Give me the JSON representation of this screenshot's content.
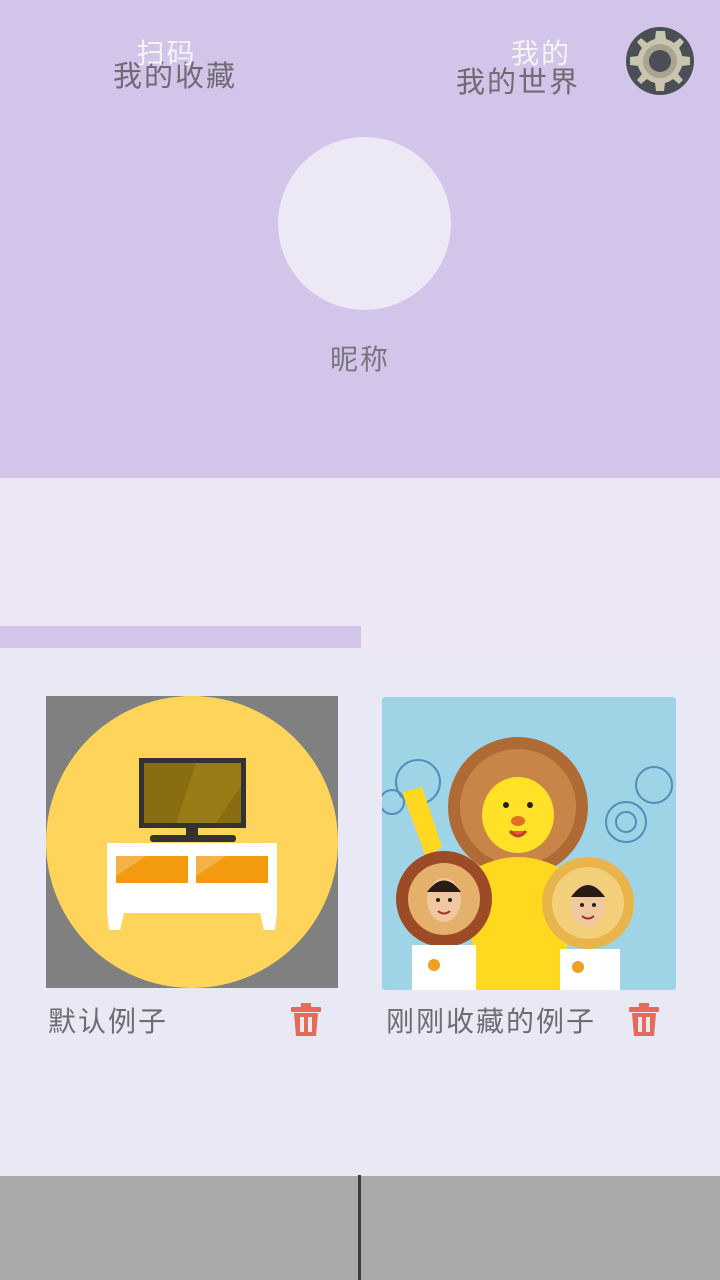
{
  "header": {
    "nickname": "昵称",
    "settings_icon": "gear-icon",
    "background_color": "#d2c5e9"
  },
  "tabs": [
    {
      "label": "我的收藏",
      "active": true
    },
    {
      "label": "我的世界",
      "active": false
    }
  ],
  "favorites": [
    {
      "label": "默认例子",
      "thumbnail_icon": "tv-cabinet-icon",
      "delete_icon": "trash-icon"
    },
    {
      "label": "刚刚收藏的例子",
      "thumbnail_icon": "mascot-photo",
      "delete_icon": "trash-icon"
    }
  ],
  "bottom_nav": [
    {
      "label": "扫码"
    },
    {
      "label": "我的"
    }
  ],
  "colors": {
    "accent": "#d2c5e9",
    "trash": "#e56a5a",
    "nav": "#a9a9a9"
  }
}
